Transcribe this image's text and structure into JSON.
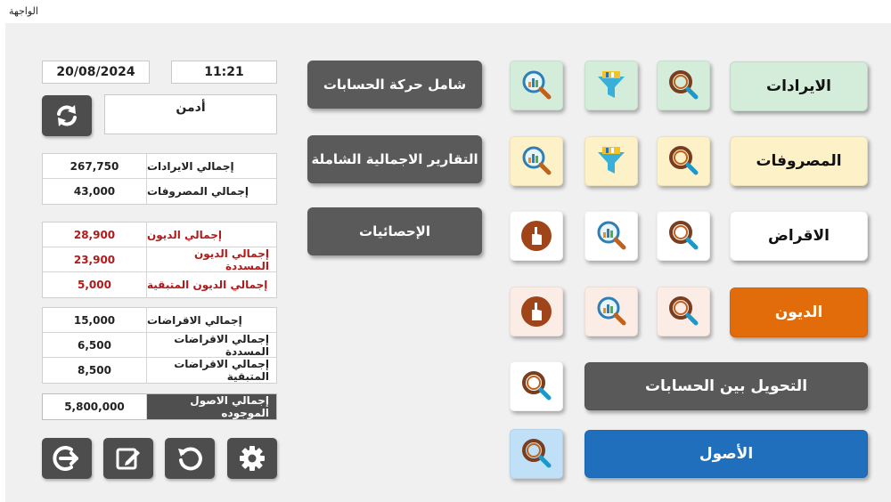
{
  "window": {
    "title": "الواجهة"
  },
  "header": {
    "date": "20/08/2024",
    "time": "11:21",
    "user": "أدمن"
  },
  "summary": {
    "group1": [
      {
        "label": "إجمالي الايرادات",
        "value": "267,750"
      },
      {
        "label": "إجمالي المصروفات",
        "value": "43,000"
      }
    ],
    "group2": [
      {
        "label": "إجمالي الديون",
        "value": "28,900"
      },
      {
        "label": "إجمالي الديون المسددة",
        "value": "23,900"
      },
      {
        "label": "إجمالي الديون المتبقية",
        "value": "5,000"
      }
    ],
    "group3": [
      {
        "label": "إجمالي الاقراضات",
        "value": "15,000"
      },
      {
        "label": "إجمالي الاقراضات المسددة",
        "value": "6,500"
      },
      {
        "label": "إجمالي الاقراضات المتبقية",
        "value": "8,500"
      }
    ],
    "assets": {
      "label": "إجمالي الاصول الموجوده",
      "value": "5,800,000"
    }
  },
  "reports": {
    "accounts_movement": "شامل حركة الحسابات",
    "comprehensive": "التقارير الاجمالية الشاملة",
    "statistics": "الإحصائيات"
  },
  "modules": {
    "revenues": "الايرادات",
    "expenses": "المصروفات",
    "loans": "الاقراض",
    "debts": "الديون",
    "transfer": "التحويل بين الحسابات",
    "assets": "الأصول"
  },
  "icons": {
    "refresh": "refresh-icon",
    "logout": "logout-icon",
    "edit": "edit-icon",
    "reset": "reset-icon",
    "settings": "gear-icon",
    "search": "search-icon",
    "filter": "filter-icon",
    "chart_search": "chart-search-icon",
    "hand": "hand-icon"
  },
  "colors": {
    "revenues_bg": "#d4eddb",
    "expenses_bg": "#fdf1c7",
    "loans_bg": "#ffffff",
    "debts_bg": "#e36c0a",
    "transfer_bg": "#595959",
    "assets_bg": "#1f6fbd",
    "assets_icon_bg": "#bfe0f7",
    "debt_icon_bg": "#fbece6"
  }
}
